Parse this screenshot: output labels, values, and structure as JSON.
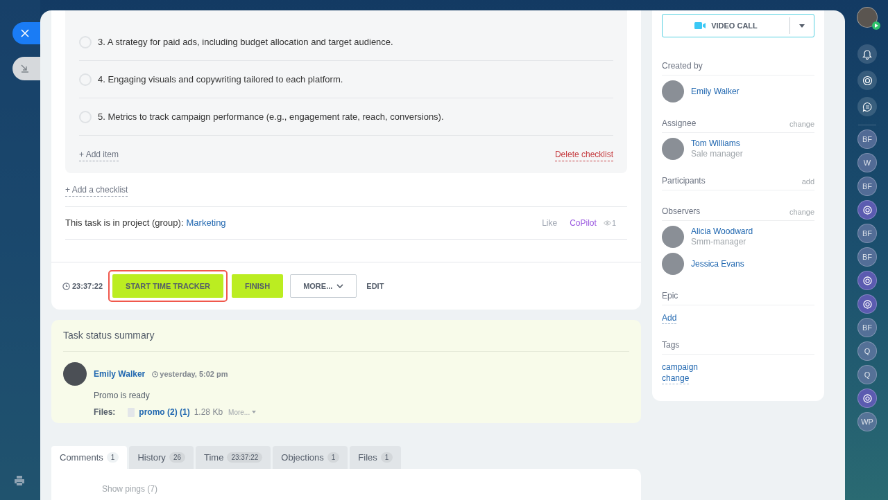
{
  "checklist": {
    "items": [
      {
        "text": "3. A strategy for paid ads, including budget allocation and target audience.",
        "checked": false
      },
      {
        "text": "4. Engaging visuals and copywriting tailored to each platform.",
        "checked": false
      },
      {
        "text": "5. Metrics to track campaign performance (e.g., engagement rate, reach, conversions).",
        "checked": false
      }
    ],
    "add_item": "+ Add item",
    "delete": "Delete checklist"
  },
  "add_checklist": "+ Add a checklist",
  "project": {
    "label": "This task is in project (group):",
    "name": "Marketing",
    "like": "Like",
    "copilot": "CoPilot",
    "views": "1"
  },
  "footer": {
    "timer": "23:37:22",
    "buttons": [
      {
        "label": "START TIME TRACKER",
        "kind": "primary",
        "highlighted": true
      },
      {
        "label": "FINISH",
        "kind": "primary",
        "highlighted": false
      },
      {
        "label": "MORE...",
        "kind": "dropdown",
        "highlighted": false
      },
      {
        "label": "EDIT",
        "kind": "text",
        "highlighted": false
      }
    ]
  },
  "summary": {
    "title": "Task status summary",
    "author": "Emily Walker",
    "time": "yesterday, 5:02 pm",
    "text": "Promo is ready",
    "files_label": "Files:",
    "file": "promo (2) (1)",
    "size": "1.28 Kb",
    "more": "More..."
  },
  "tabs": [
    {
      "label": "Comments",
      "count": "1",
      "selected": true
    },
    {
      "label": "History",
      "count": "26",
      "selected": false
    },
    {
      "label": "Time",
      "count": "23:37:22",
      "selected": false
    },
    {
      "label": "Objections",
      "count": "1",
      "selected": false
    },
    {
      "label": "Files",
      "count": "1",
      "selected": false
    }
  ],
  "show_pings": "Show pings (7)",
  "sidebar": {
    "video_call": "VIDEO CALL",
    "sections": [
      {
        "title": "Created by",
        "people": [
          {
            "name": "Emily Walker"
          }
        ]
      },
      {
        "title": "Assignee",
        "action": "change",
        "people": [
          {
            "name": "Tom Williams",
            "role": "Sale manager"
          }
        ]
      },
      {
        "title": "Participants",
        "action": "add"
      },
      {
        "title": "Observers",
        "action": "change",
        "people": [
          {
            "name": "Alicia Woodward",
            "role": "Smm-manager"
          },
          {
            "name": "Jessica Evans"
          }
        ]
      },
      {
        "title": "Epic",
        "links": [
          "Add"
        ]
      },
      {
        "title": "Tags",
        "tags": [
          "campaign"
        ],
        "links": [
          "change"
        ]
      }
    ]
  },
  "rail": [
    {
      "kind": "initials",
      "text": "BF"
    },
    {
      "kind": "initials",
      "text": "W"
    },
    {
      "kind": "initials",
      "text": "BF"
    },
    {
      "kind": "copilot"
    },
    {
      "kind": "initials",
      "text": "BF"
    },
    {
      "kind": "initials",
      "text": "BF"
    },
    {
      "kind": "copilot"
    },
    {
      "kind": "copilot"
    },
    {
      "kind": "initials",
      "text": "BF"
    },
    {
      "kind": "initials",
      "text": "Q"
    },
    {
      "kind": "initials",
      "text": "Q"
    },
    {
      "kind": "copilot"
    },
    {
      "kind": "initials",
      "text": "WP"
    }
  ]
}
